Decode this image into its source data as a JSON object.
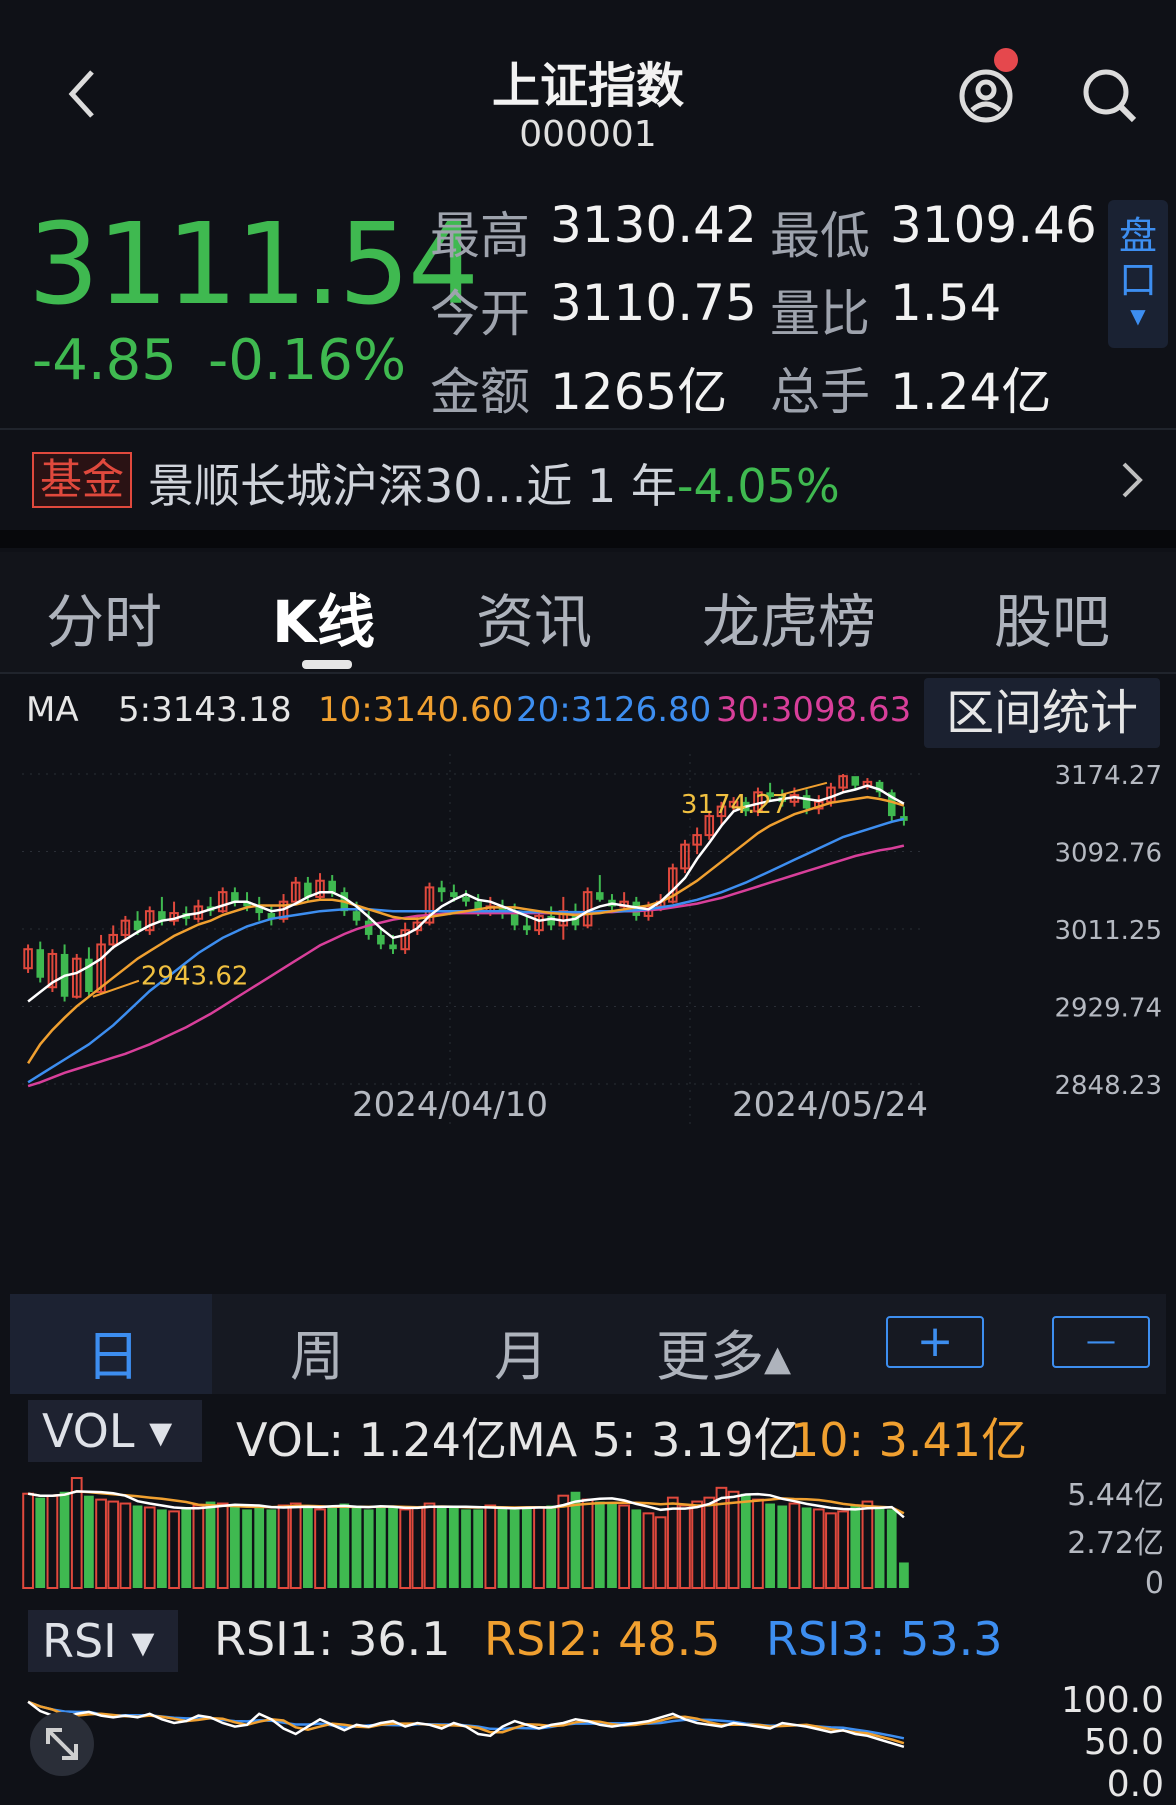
{
  "header": {
    "title": "上证指数",
    "code": "000001",
    "back_icon": "chevron-left-icon",
    "user_icon": "user-icon",
    "search_icon": "search-icon",
    "notification_dot": "#e5484d"
  },
  "quote": {
    "price": "3111.54",
    "change": "-4.85",
    "change_pct": "-0.16%",
    "high_label": "最高",
    "high": "3130.42",
    "low_label": "最低",
    "low": "3109.46",
    "open_label": "今开",
    "open": "3110.75",
    "vol_ratio_label": "量比",
    "vol_ratio": "1.54",
    "amount_label": "金额",
    "amount": "1265亿",
    "turnover_label": "总手",
    "turnover": "1.24亿",
    "pankou_label_1": "盘",
    "pankou_label_2": "口",
    "down_color": "#3fb950",
    "up_color": "#e0493d"
  },
  "fund": {
    "tag": "基金",
    "name": "景顺长城沪深30...近 1 年",
    "return": "-4.05%"
  },
  "tabs": [
    "分时",
    "K线",
    "资讯",
    "龙虎榜",
    "股吧"
  ],
  "ma_row": {
    "label": "MA",
    "ma5": "5:3143.18",
    "ma10": "10:3140.60",
    "ma20": "20:3126.80",
    "ma30": "30:3098.63",
    "range_button": "区间统计"
  },
  "kline": {
    "price_axis": [
      "3174.27",
      "3092.76",
      "3011.25",
      "2929.74",
      "2848.23"
    ],
    "date_labels": [
      "2024/04/10",
      "2024/05/24"
    ],
    "high_annotation": "3174.27",
    "low_annotation": "2943.62"
  },
  "periods": {
    "day": "日",
    "week": "周",
    "month": "月",
    "more": "更多▴",
    "zoom_in": "+",
    "zoom_out": "—"
  },
  "vol": {
    "selector": "VOL ▾",
    "vol": "VOL:  1.24亿",
    "ma5": "MA 5:  3.19亿",
    "ma10": "10:  3.41亿",
    "axis": [
      "5.44亿",
      "2.72亿",
      "0"
    ]
  },
  "rsi": {
    "selector": "RSI ▾",
    "rsi1": "RSI1:  36.1",
    "rsi2": "RSI2:  48.5",
    "rsi3": "RSI3:  53.3",
    "axis": [
      "100.0",
      "50.0",
      "0.0"
    ],
    "expand_icon": "expand-arrows-icon"
  },
  "chart_data": {
    "type": "candlestick",
    "ylim": [
      2848.23,
      3174.27
    ],
    "candles": [
      {
        "o": 2970,
        "c": 2990,
        "h": 2995,
        "l": 2965
      },
      {
        "o": 2990,
        "c": 2960,
        "h": 2998,
        "l": 2955
      },
      {
        "o": 2950,
        "c": 2985,
        "h": 2990,
        "l": 2945
      },
      {
        "o": 2985,
        "c": 2940,
        "h": 2995,
        "l": 2935
      },
      {
        "o": 2940,
        "c": 2980,
        "h": 2985,
        "l": 2938
      },
      {
        "o": 2980,
        "c": 2945,
        "h": 2992,
        "l": 2940
      },
      {
        "o": 2945,
        "c": 2995,
        "h": 3005,
        "l": 2943
      },
      {
        "o": 2995,
        "c": 3005,
        "h": 3015,
        "l": 2990
      },
      {
        "o": 3005,
        "c": 3020,
        "h": 3025,
        "l": 3000
      },
      {
        "o": 3020,
        "c": 3010,
        "h": 3030,
        "l": 3005
      },
      {
        "o": 3010,
        "c": 3030,
        "h": 3035,
        "l": 3005
      },
      {
        "o": 3030,
        "c": 3020,
        "h": 3045,
        "l": 3015
      },
      {
        "o": 3020,
        "c": 3028,
        "h": 3040,
        "l": 3015
      },
      {
        "o": 3028,
        "c": 3022,
        "h": 3035,
        "l": 3015
      },
      {
        "o": 3022,
        "c": 3035,
        "h": 3042,
        "l": 3018
      },
      {
        "o": 3035,
        "c": 3030,
        "h": 3045,
        "l": 3025
      },
      {
        "o": 3030,
        "c": 3050,
        "h": 3055,
        "l": 3028
      },
      {
        "o": 3050,
        "c": 3040,
        "h": 3055,
        "l": 3035
      },
      {
        "o": 3040,
        "c": 3035,
        "h": 3050,
        "l": 3030
      },
      {
        "o": 3035,
        "c": 3028,
        "h": 3045,
        "l": 3020
      },
      {
        "o": 3028,
        "c": 3022,
        "h": 3035,
        "l": 3015
      },
      {
        "o": 3022,
        "c": 3040,
        "h": 3048,
        "l": 3018
      },
      {
        "o": 3040,
        "c": 3060,
        "h": 3066,
        "l": 3038
      },
      {
        "o": 3060,
        "c": 3045,
        "h": 3066,
        "l": 3040
      },
      {
        "o": 3045,
        "c": 3062,
        "h": 3070,
        "l": 3042
      },
      {
        "o": 3062,
        "c": 3050,
        "h": 3068,
        "l": 3045
      },
      {
        "o": 3050,
        "c": 3030,
        "h": 3055,
        "l": 3025
      },
      {
        "o": 3030,
        "c": 3020,
        "h": 3040,
        "l": 3015
      },
      {
        "o": 3020,
        "c": 3005,
        "h": 3030,
        "l": 3000
      },
      {
        "o": 3005,
        "c": 2995,
        "h": 3012,
        "l": 2990
      },
      {
        "o": 2995,
        "c": 2990,
        "h": 3005,
        "l": 2985
      },
      {
        "o": 2990,
        "c": 3010,
        "h": 3018,
        "l": 2985
      },
      {
        "o": 3010,
        "c": 3018,
        "h": 3025,
        "l": 3005
      },
      {
        "o": 3018,
        "c": 3055,
        "h": 3060,
        "l": 3015
      },
      {
        "o": 3055,
        "c": 3050,
        "h": 3062,
        "l": 3040
      },
      {
        "o": 3050,
        "c": 3045,
        "h": 3058,
        "l": 3040
      },
      {
        "o": 3045,
        "c": 3040,
        "h": 3052,
        "l": 3035
      },
      {
        "o": 3040,
        "c": 3030,
        "h": 3048,
        "l": 3025
      },
      {
        "o": 3030,
        "c": 3035,
        "h": 3045,
        "l": 3025
      },
      {
        "o": 3035,
        "c": 3030,
        "h": 3042,
        "l": 3022
      },
      {
        "o": 3030,
        "c": 3015,
        "h": 3038,
        "l": 3010
      },
      {
        "o": 3015,
        "c": 3010,
        "h": 3025,
        "l": 3005
      },
      {
        "o": 3010,
        "c": 3025,
        "h": 3030,
        "l": 3005
      },
      {
        "o": 3025,
        "c": 3015,
        "h": 3035,
        "l": 3010
      },
      {
        "o": 3015,
        "c": 3030,
        "h": 3045,
        "l": 3000
      },
      {
        "o": 3030,
        "c": 3015,
        "h": 3038,
        "l": 3010
      },
      {
        "o": 3015,
        "c": 3050,
        "h": 3055,
        "l": 3012
      },
      {
        "o": 3050,
        "c": 3042,
        "h": 3068,
        "l": 3040
      },
      {
        "o": 3042,
        "c": 3035,
        "h": 3048,
        "l": 3030
      },
      {
        "o": 3035,
        "c": 3040,
        "h": 3050,
        "l": 3030
      },
      {
        "o": 3040,
        "c": 3025,
        "h": 3045,
        "l": 3020
      },
      {
        "o": 3025,
        "c": 3035,
        "h": 3040,
        "l": 3020
      },
      {
        "o": 3035,
        "c": 3040,
        "h": 3048,
        "l": 3030
      },
      {
        "o": 3040,
        "c": 3075,
        "h": 3080,
        "l": 3038
      },
      {
        "o": 3075,
        "c": 3100,
        "h": 3105,
        "l": 3070
      },
      {
        "o": 3100,
        "c": 3110,
        "h": 3118,
        "l": 3090
      },
      {
        "o": 3110,
        "c": 3130,
        "h": 3135,
        "l": 3105
      },
      {
        "o": 3130,
        "c": 3140,
        "h": 3145,
        "l": 3120
      },
      {
        "o": 3140,
        "c": 3145,
        "h": 3150,
        "l": 3135
      },
      {
        "o": 3145,
        "c": 3135,
        "h": 3150,
        "l": 3130
      },
      {
        "o": 3135,
        "c": 3155,
        "h": 3160,
        "l": 3130
      },
      {
        "o": 3155,
        "c": 3150,
        "h": 3165,
        "l": 3145
      },
      {
        "o": 3150,
        "c": 3145,
        "h": 3158,
        "l": 3140
      },
      {
        "o": 3145,
        "c": 3152,
        "h": 3160,
        "l": 3140
      },
      {
        "o": 3152,
        "c": 3138,
        "h": 3158,
        "l": 3132
      },
      {
        "o": 3138,
        "c": 3145,
        "h": 3152,
        "l": 3132
      },
      {
        "o": 3145,
        "c": 3160,
        "h": 3165,
        "l": 3140
      },
      {
        "o": 3160,
        "c": 3172,
        "h": 3174.27,
        "l": 3155
      },
      {
        "o": 3172,
        "c": 3162,
        "h": 3170,
        "l": 3158
      },
      {
        "o": 3162,
        "c": 3166,
        "h": 3170,
        "l": 3158
      },
      {
        "o": 3166,
        "c": 3155,
        "h": 3168,
        "l": 3150
      },
      {
        "o": 3155,
        "c": 3130,
        "h": 3158,
        "l": 3125
      },
      {
        "o": 3130,
        "c": 3125,
        "h": 3140,
        "l": 3120
      }
    ],
    "ma5": [
      2935,
      2945,
      2955,
      2962,
      2965,
      2972,
      2980,
      2992,
      3000,
      3008,
      3015,
      3020,
      3022,
      3026,
      3028,
      3032,
      3036,
      3040,
      3040,
      3035,
      3030,
      3032,
      3038,
      3045,
      3050,
      3050,
      3044,
      3035,
      3024,
      3012,
      3002,
      3005,
      3012,
      3025,
      3035,
      3042,
      3048,
      3042,
      3040,
      3035,
      3030,
      3025,
      3020,
      3022,
      3020,
      3022,
      3030,
      3035,
      3038,
      3036,
      3034,
      3032,
      3040,
      3052,
      3065,
      3085,
      3102,
      3120,
      3135,
      3140,
      3143,
      3146,
      3148,
      3150,
      3148,
      3146,
      3150,
      3155,
      3158,
      3162,
      3158,
      3150,
      3143
    ],
    "ma10": [
      2870,
      2890,
      2905,
      2918,
      2930,
      2940,
      2950,
      2960,
      2970,
      2980,
      2988,
      2996,
      3004,
      3010,
      3016,
      3020,
      3026,
      3030,
      3034,
      3036,
      3036,
      3036,
      3037,
      3040,
      3042,
      3042,
      3040,
      3036,
      3032,
      3028,
      3024,
      3022,
      3022,
      3024,
      3026,
      3028,
      3030,
      3032,
      3034,
      3034,
      3034,
      3032,
      3030,
      3028,
      3027,
      3026,
      3027,
      3028,
      3030,
      3032,
      3034,
      3036,
      3040,
      3046,
      3054,
      3062,
      3072,
      3082,
      3092,
      3102,
      3112,
      3120,
      3126,
      3132,
      3136,
      3140,
      3144,
      3146,
      3148,
      3150,
      3148,
      3145,
      3141
    ],
    "ma20": [
      2850,
      2858,
      2866,
      2874,
      2882,
      2890,
      2900,
      2910,
      2922,
      2934,
      2946,
      2956,
      2966,
      2976,
      2986,
      2994,
      3002,
      3008,
      3014,
      3018,
      3022,
      3024,
      3026,
      3028,
      3030,
      3031,
      3032,
      3032,
      3032,
      3031,
      3030,
      3030,
      3030,
      3030,
      3030,
      3030,
      3030,
      3030,
      3030,
      3030,
      3030,
      3029,
      3029,
      3029,
      3029,
      3029,
      3029,
      3030,
      3030,
      3030,
      3031,
      3032,
      3034,
      3036,
      3039,
      3042,
      3046,
      3050,
      3055,
      3060,
      3066,
      3072,
      3078,
      3084,
      3090,
      3096,
      3102,
      3108,
      3112,
      3116,
      3120,
      3124,
      3127
    ],
    "ma30": [
      2846,
      2850,
      2855,
      2860,
      2864,
      2868,
      2872,
      2876,
      2880,
      2885,
      2890,
      2896,
      2902,
      2908,
      2915,
      2922,
      2930,
      2938,
      2946,
      2954,
      2962,
      2970,
      2978,
      2986,
      2994,
      3000,
      3006,
      3011,
      3015,
      3018,
      3021,
      3023,
      3025,
      3026,
      3027,
      3028,
      3028,
      3028,
      3028,
      3028,
      3028,
      3028,
      3028,
      3028,
      3028,
      3028,
      3028,
      3029,
      3029,
      3030,
      3030,
      3031,
      3032,
      3034,
      3036,
      3038,
      3041,
      3044,
      3048,
      3052,
      3056,
      3060,
      3064,
      3068,
      3072,
      3076,
      3080,
      3084,
      3088,
      3091,
      3094,
      3096,
      3099
    ],
    "volume_axis_max": "5.44亿",
    "volume_bars": [
      4.8,
      4.6,
      4.7,
      4.9,
      5.6,
      4.7,
      4.5,
      4.4,
      4.3,
      4.2,
      4.1,
      4.0,
      3.9,
      4.1,
      4.2,
      4.4,
      4.3,
      4.2,
      4.0,
      4.1,
      4.0,
      4.2,
      4.3,
      4.1,
      4.0,
      4.2,
      4.3,
      4.1,
      4.0,
      4.2,
      4.1,
      4.0,
      4.1,
      4.3,
      4.2,
      4.1,
      4.0,
      4.0,
      4.2,
      4.1,
      4.0,
      4.1,
      4.1,
      4.2,
      4.7,
      4.9,
      4.5,
      4.4,
      4.3,
      4.2,
      4.0,
      3.8,
      3.6,
      4.6,
      4.2,
      4.4,
      4.6,
      5.1,
      4.9,
      4.8,
      4.5,
      4.3,
      4.2,
      4.3,
      4.1,
      4.0,
      3.8,
      3.9,
      4.2,
      4.4,
      4.1,
      4.0,
      1.3
    ],
    "rsi": [
      85,
      75,
      70,
      68,
      72,
      74,
      70,
      68,
      70,
      68,
      72,
      66,
      62,
      64,
      70,
      68,
      62,
      58,
      60,
      72,
      66,
      56,
      50,
      58,
      66,
      60,
      54,
      60,
      58,
      62,
      64,
      58,
      62,
      60,
      56,
      62,
      58,
      50,
      48,
      58,
      64,
      60,
      56,
      60,
      62,
      66,
      64,
      60,
      58,
      60,
      62,
      64,
      68,
      72,
      66,
      62,
      60,
      58,
      62,
      60,
      58,
      56,
      62,
      60,
      58,
      55,
      52,
      54,
      50,
      48,
      44,
      40,
      36.1
    ]
  }
}
